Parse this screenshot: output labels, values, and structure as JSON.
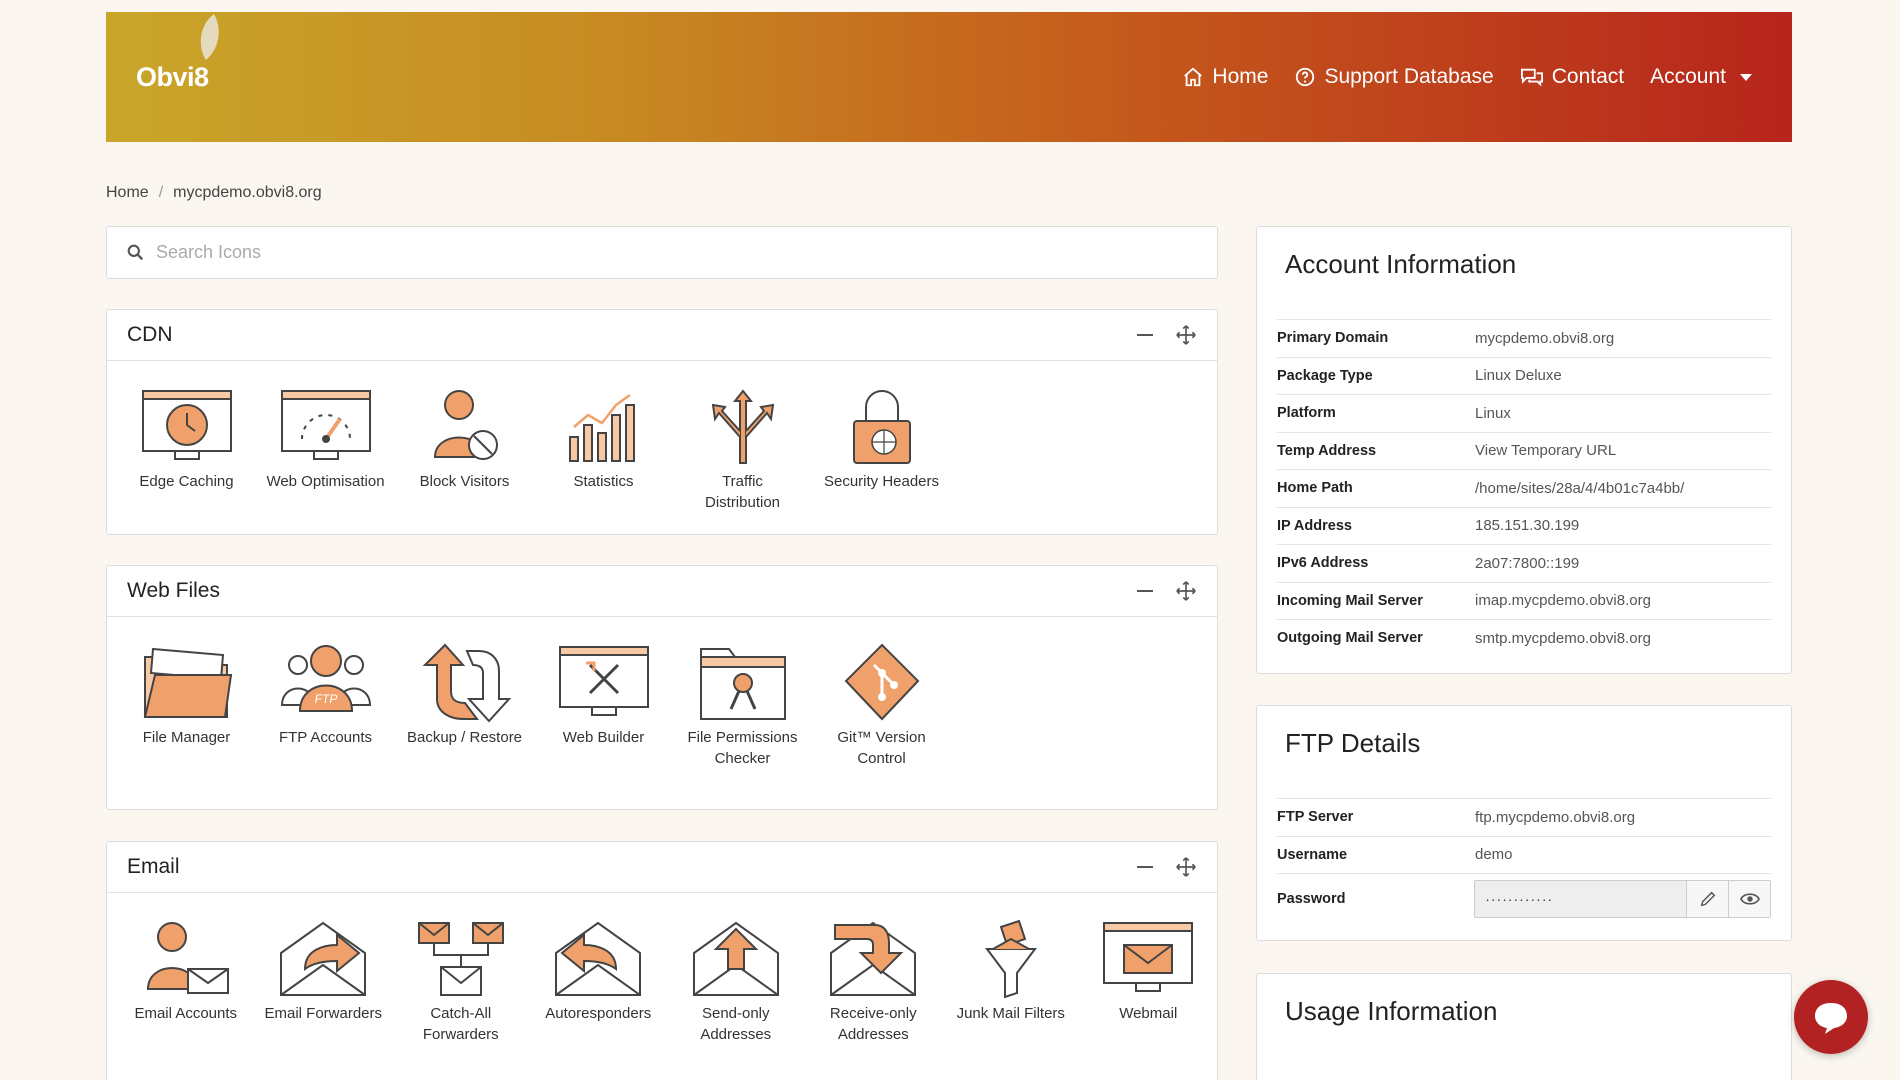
{
  "header": {
    "logo": "Obvi8",
    "nav": [
      {
        "label": "Home",
        "icon": "home-icon"
      },
      {
        "label": "Support Database",
        "icon": "question-circle-icon"
      },
      {
        "label": "Contact",
        "icon": "chat-bubbles-icon"
      },
      {
        "label": "Account",
        "icon": "caret-down-icon"
      }
    ]
  },
  "breadcrumb": [
    "Home",
    "mycpdemo.obvi8.org"
  ],
  "search": {
    "placeholder": "Search Icons"
  },
  "sections": [
    {
      "title": "CDN",
      "items": [
        "Edge Caching",
        "Web Optimisation",
        "Block Visitors",
        "Statistics",
        "Traffic Distribution",
        "Security Headers"
      ]
    },
    {
      "title": "Web Files",
      "items": [
        "File Manager",
        "FTP Accounts",
        "Backup / Restore",
        "Web Builder",
        "File Permissions Checker",
        "Git™ Version Control"
      ]
    },
    {
      "title": "Email",
      "items": [
        "Email Accounts",
        "Email Forwarders",
        "Catch-All Forwarders",
        "Autoresponders",
        "Send-only Addresses",
        "Receive-only Addresses",
        "Junk Mail Filters",
        "Webmail"
      ]
    }
  ],
  "account_info": {
    "title": "Account Information",
    "rows": [
      {
        "key": "Primary Domain",
        "value": "mycpdemo.obvi8.org"
      },
      {
        "key": "Package Type",
        "value": "Linux Deluxe"
      },
      {
        "key": "Platform",
        "value": "Linux"
      },
      {
        "key": "Temp Address",
        "value": "View Temporary URL"
      },
      {
        "key": "Home Path",
        "value": "/home/sites/28a/4/4b01c7a4bb/"
      },
      {
        "key": "IP Address",
        "value": "185.151.30.199"
      },
      {
        "key": "IPv6 Address",
        "value": "2a07:7800::199"
      },
      {
        "key": "Incoming Mail Server",
        "value": "imap.mycpdemo.obvi8.org"
      },
      {
        "key": "Outgoing Mail Server",
        "value": "smtp.mycpdemo.obvi8.org"
      }
    ]
  },
  "ftp": {
    "title": "FTP Details",
    "server_label": "FTP Server",
    "server": "ftp.mycpdemo.obvi8.org",
    "user_label": "Username",
    "user": "demo",
    "pw_label": "Password",
    "pw": "············"
  },
  "usage": {
    "title": "Usage Information"
  },
  "colors": {
    "accent": "#e8844a",
    "accent_fill": "#f7c9a4",
    "header_start": "#c9a62a",
    "header_end": "#b7251c",
    "chat": "#b22222"
  }
}
